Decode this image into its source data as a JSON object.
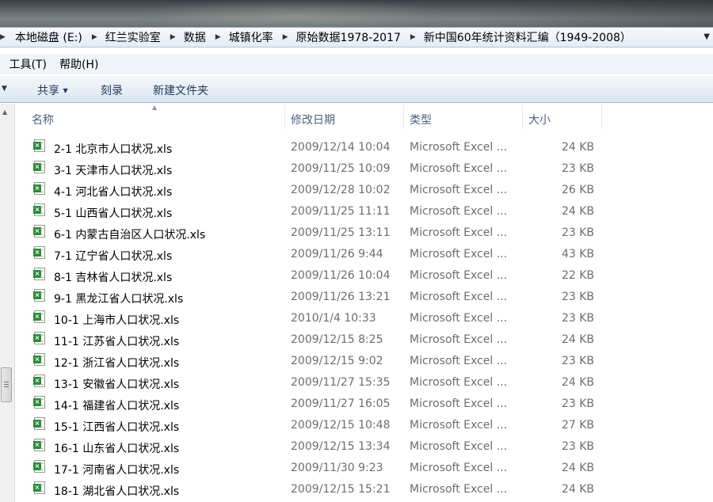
{
  "address": {
    "crumbs": [
      "本地磁盘 (E:)",
      "红兰实验室",
      "数据",
      "城镇化率",
      "原始数据1978-2017",
      "新中国60年统计资料汇编（1949-2008）"
    ]
  },
  "menu": {
    "partial": ")",
    "tools": "工具(T)",
    "help": "帮助(H)"
  },
  "toolbar": {
    "share": "共享",
    "burn": "刻录",
    "new_folder": "新建文件夹"
  },
  "columns": {
    "name": "名称",
    "modified": "修改日期",
    "type": "类型",
    "size": "大小"
  },
  "files": [
    {
      "name": "2-1  北京市人口状况.xls",
      "date": "2009/12/14 10:04",
      "type": "Microsoft Excel ...",
      "size": "24 KB"
    },
    {
      "name": "3-1  天津市人口状况.xls",
      "date": "2009/11/25 10:09",
      "type": "Microsoft Excel ...",
      "size": "23 KB"
    },
    {
      "name": "4-1  河北省人口状况.xls",
      "date": "2009/12/28 10:02",
      "type": "Microsoft Excel ...",
      "size": "26 KB"
    },
    {
      "name": "5-1  山西省人口状况.xls",
      "date": "2009/11/25 11:11",
      "type": "Microsoft Excel ...",
      "size": "24 KB"
    },
    {
      "name": "6-1  内蒙古自治区人口状况.xls",
      "date": "2009/11/25 13:11",
      "type": "Microsoft Excel ...",
      "size": "23 KB"
    },
    {
      "name": "7-1  辽宁省人口状况.xls",
      "date": "2009/11/26 9:44",
      "type": "Microsoft Excel ...",
      "size": "43 KB"
    },
    {
      "name": "8-1  吉林省人口状况.xls",
      "date": "2009/11/26 10:04",
      "type": "Microsoft Excel ...",
      "size": "22 KB"
    },
    {
      "name": "9-1  黑龙江省人口状况.xls",
      "date": "2009/11/26 13:21",
      "type": "Microsoft Excel ...",
      "size": "23 KB"
    },
    {
      "name": "10-1  上海市人口状况.xls",
      "date": "2010/1/4 10:33",
      "type": "Microsoft Excel ...",
      "size": "23 KB"
    },
    {
      "name": "11-1  江苏省人口状况.xls",
      "date": "2009/12/15 8:25",
      "type": "Microsoft Excel ...",
      "size": "24 KB"
    },
    {
      "name": "12-1  浙江省人口状况.xls",
      "date": "2009/12/15 9:02",
      "type": "Microsoft Excel ...",
      "size": "23 KB"
    },
    {
      "name": "13-1  安徽省人口状况.xls",
      "date": "2009/11/27 15:35",
      "type": "Microsoft Excel ...",
      "size": "24 KB"
    },
    {
      "name": "14-1  福建省人口状况.xls",
      "date": "2009/11/27 16:05",
      "type": "Microsoft Excel ...",
      "size": "23 KB"
    },
    {
      "name": "15-1  江西省人口状况.xls",
      "date": "2009/12/15 10:48",
      "type": "Microsoft Excel ...",
      "size": "27 KB"
    },
    {
      "name": "16-1  山东省人口状况.xls",
      "date": "2009/12/15 13:34",
      "type": "Microsoft Excel ...",
      "size": "23 KB"
    },
    {
      "name": "17-1  河南省人口状况.xls",
      "date": "2009/11/30 9:23",
      "type": "Microsoft Excel ...",
      "size": "24 KB"
    },
    {
      "name": "18-1  湖北省人口状况.xls",
      "date": "2009/12/15 15:21",
      "type": "Microsoft Excel ...",
      "size": "24 KB"
    }
  ]
}
